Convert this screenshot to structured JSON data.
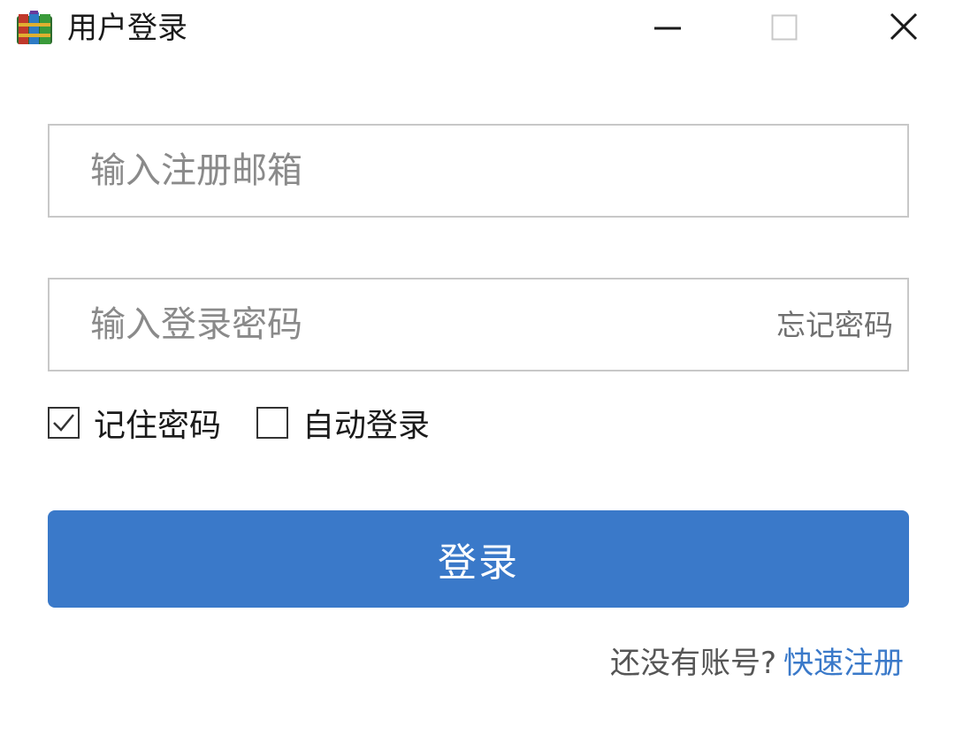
{
  "window": {
    "title": "用户登录",
    "app_icon": "winrar-books-icon",
    "controls": [
      "minimize-icon",
      "maximize-icon",
      "close-icon"
    ]
  },
  "form": {
    "email_placeholder": "输入注册邮箱",
    "email_value": "",
    "password_placeholder": "输入登录密码",
    "password_value": "",
    "forgot_password": "忘记密码",
    "remember_password": {
      "label": "记住密码",
      "checked": true
    },
    "auto_login": {
      "label": "自动登录",
      "checked": false
    },
    "login_button": "登录"
  },
  "footer": {
    "no_account": "还没有账号?",
    "register": "快速注册"
  },
  "colors": {
    "accent": "#3a79c9",
    "border": "#c8c8c8",
    "placeholder": "#8a8a8a"
  }
}
